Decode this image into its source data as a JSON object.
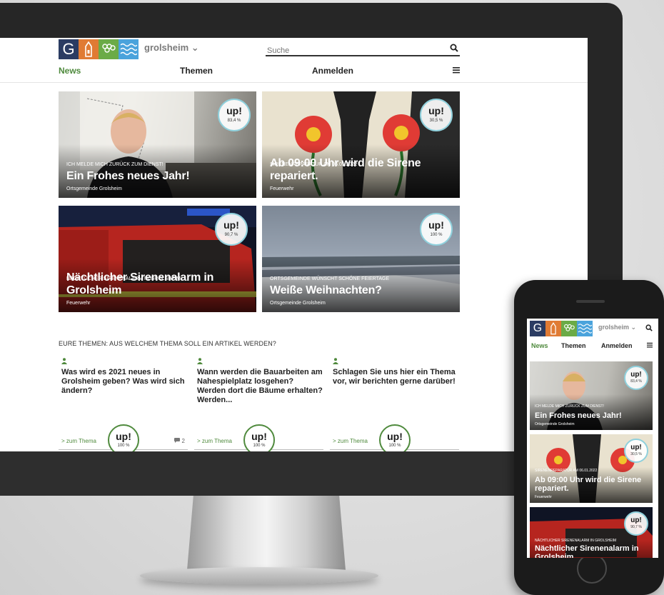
{
  "site": {
    "brand": "grolsheim ⌄",
    "logo_letter": "G"
  },
  "search": {
    "placeholder": "Suche"
  },
  "nav": {
    "news": "News",
    "themen": "Themen",
    "anmelden": "Anmelden"
  },
  "colors": {
    "accent_green": "#4f8a3d",
    "badge_ring": "#8fd0dc",
    "logo_navy": "#2b3c63",
    "logo_orange": "#e07b34",
    "logo_green": "#6bab47",
    "logo_blue": "#4aa3dc"
  },
  "articles": [
    {
      "kicker": "Ich melde mich zurück zum Dienst!",
      "title": "Ein Frohes neues Jahr!",
      "source": "Ortsgemeinde Grolsheim",
      "badge": "up!",
      "percent": "83,4 %"
    },
    {
      "kicker": "Sirenenreparatur am 06.01.2022",
      "title": "Ab 09:00 Uhr wird die Sirene repariert.",
      "source": "Feuerwehr",
      "badge": "up!",
      "percent": "30,5 %"
    },
    {
      "kicker": "Nächtlicher Sirenenalarm in Grolsheim",
      "title": "Nächtlicher Sirenenalarm in Grolsheim",
      "source": "Feuerwehr",
      "badge": "up!",
      "percent": "90,7 %"
    },
    {
      "kicker": "Ortsgemeinde wünscht schöne Feiertage",
      "title": "Weiße Weihnachten?",
      "source": "Ortsgemeinde Grolsheim",
      "badge": "up!",
      "percent": "100 %"
    }
  ],
  "themes": {
    "heading": "EURE THEMEN: AUS WELCHEM THEMA SOLL EIN ARTIKEL WERDEN?",
    "items": [
      {
        "question": "Was wird es 2021 neues in Grolsheim geben? Was wird sich ändern?",
        "link": "> zum Thema",
        "comments": "2",
        "badge": "up!",
        "percent": "100 %"
      },
      {
        "question": "Wann werden die Bauarbeiten am Nahespielplatz losgehen? Werden dort die Bäume erhalten? Werden...",
        "link": "> zum Thema",
        "comments": "",
        "badge": "up!",
        "percent": "100 %"
      },
      {
        "question": "Schlagen Sie uns hier ein Thema vor, wir berichten gerne darüber!",
        "link": "> zum Thema",
        "comments": "",
        "badge": "up!",
        "percent": "100 %"
      }
    ]
  },
  "mobile": {
    "brand": "grolsheim ⌄",
    "nav": {
      "news": "News",
      "themen": "Themen",
      "anmelden": "Anmelden"
    },
    "articles": [
      {
        "kicker": "Ich melde mich zurück zum Dienst!",
        "title": "Ein Frohes neues Jahr!",
        "source": "Ortsgemeinde Grolsheim",
        "badge": "up!",
        "percent": "83,4 %"
      },
      {
        "kicker": "Sirenenreparatur am 06.01.2022",
        "title": "Ab 09:00 Uhr wird die Sirene repariert.",
        "source": "Feuerwehr",
        "badge": "up!",
        "percent": "30,5 %"
      },
      {
        "kicker": "Nächtlicher Sirenenalarm in Grolsheim",
        "title": "Nächtlicher Sirenenalarm in Grolsheim",
        "source": "",
        "badge": "up!",
        "percent": "90,7 %"
      }
    ]
  }
}
